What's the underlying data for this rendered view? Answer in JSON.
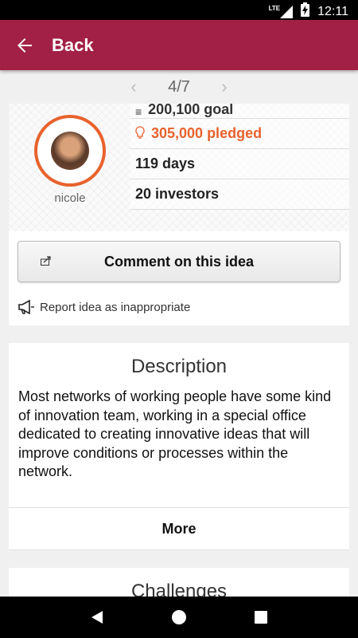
{
  "status_bar": {
    "network": "LTE",
    "time": "12:11"
  },
  "app_bar": {
    "back_label": "Back"
  },
  "pager": {
    "current": "4/7"
  },
  "idea": {
    "author": "nicole",
    "goal_text": "200,100 goal",
    "pledged_text": "305,000 pledged",
    "days_text": "119 days",
    "investors_text": "20 investors"
  },
  "actions": {
    "comment_label": "Comment on this idea",
    "report_label": "Report idea as inappropriate"
  },
  "description": {
    "title": "Description",
    "body": "Most networks of working people have some kind of innovation team, working in a special office dedicated to creating innovative ideas that will improve conditions or processes within the network.",
    "more_label": "More"
  },
  "challenges": {
    "title": "Challenges"
  },
  "colors": {
    "primary": "#a22046",
    "accent": "#e8622c"
  }
}
